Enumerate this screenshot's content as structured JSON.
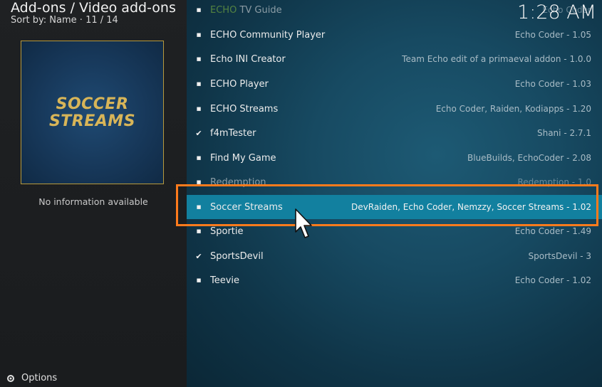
{
  "header": {
    "title": "Add-ons / Video add-ons",
    "sort": "Sort by: Name",
    "position": "11 / 14",
    "clock": "1:28 AM"
  },
  "preview": {
    "logo_line1": "SOCCER",
    "logo_line2": "STREAMS",
    "info": "No information available"
  },
  "footer": {
    "options_label": "Options"
  },
  "list": {
    "items": [
      {
        "prefix": "ECHO",
        "name": " TV Guide",
        "author": "Echo Coder",
        "marker": "dot",
        "state": "faded"
      },
      {
        "name": "ECHO Community Player",
        "author": "Echo Coder - 1.05",
        "marker": "dot"
      },
      {
        "name": "Echo INI Creator",
        "author": "Team Echo edit of a primaeval addon - 1.0.0",
        "marker": "dot"
      },
      {
        "name": "ECHO Player",
        "author": "Echo Coder - 1.03",
        "marker": "dot"
      },
      {
        "name": "ECHO Streams",
        "author": "Echo Coder, Raiden, Kodiapps - 1.20",
        "marker": "dot"
      },
      {
        "name": "f4mTester",
        "author": "Shani - 2.7.1",
        "marker": "check"
      },
      {
        "name": "Find My Game",
        "author": "BlueBuilds, EchoCoder - 2.08",
        "marker": "dot"
      },
      {
        "name": "Redemption",
        "author": "Redemption - 1.0",
        "marker": "dot",
        "state": "faded"
      },
      {
        "name": "Soccer Streams",
        "author": "DevRaiden, Echo Coder, Nemzzy, Soccer Streams - 1.02",
        "marker": "dot",
        "state": "selected"
      },
      {
        "name": "Sportie",
        "author": "Echo Coder - 1.49",
        "marker": "dot"
      },
      {
        "name": "SportsDevil",
        "author": "SportsDevil - 3",
        "marker": "check"
      },
      {
        "name": "Teevie",
        "author": "Echo Coder - 1.02",
        "marker": "dot"
      }
    ]
  },
  "colors": {
    "accent_selected": "#12809f",
    "highlight_border": "#ff7b1c",
    "logo_gold": "#d8b558",
    "echo_green": "#8cc63f"
  }
}
